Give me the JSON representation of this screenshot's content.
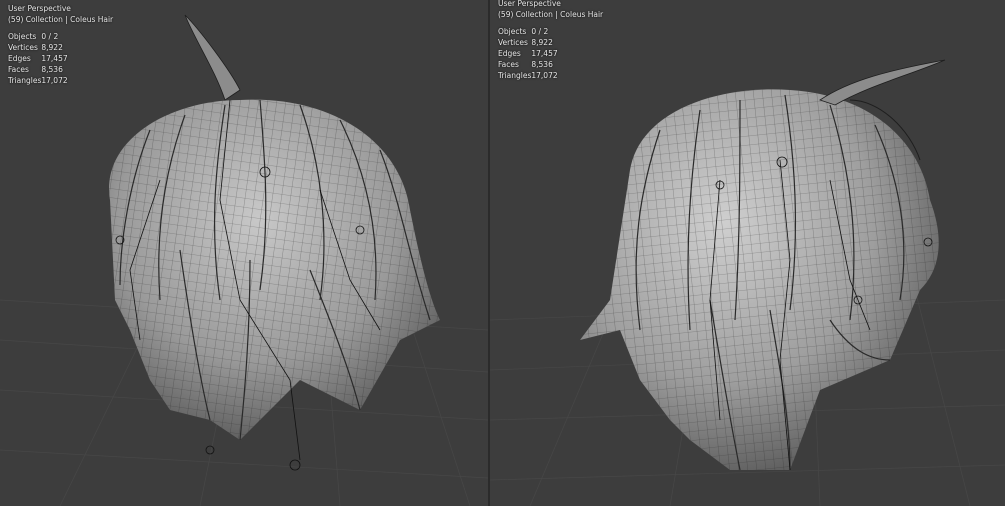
{
  "viewports": [
    {
      "perspective": "User Perspective",
      "collection": "(59) Collection | Coleus Hair",
      "stats": [
        {
          "label": "Objects",
          "value": "0 / 2"
        },
        {
          "label": "Vertices",
          "value": "8,922"
        },
        {
          "label": "Edges",
          "value": "17,457"
        },
        {
          "label": "Faces",
          "value": "8,536"
        },
        {
          "label": "Triangles",
          "value": "17,072"
        }
      ]
    },
    {
      "perspective": "User Perspective",
      "collection": "(59) Collection | Coleus Hair",
      "stats": [
        {
          "label": "Objects",
          "value": "0 / 2"
        },
        {
          "label": "Vertices",
          "value": "8,922"
        },
        {
          "label": "Edges",
          "value": "17,457"
        },
        {
          "label": "Faces",
          "value": "8,536"
        },
        {
          "label": "Triangles",
          "value": "17,072"
        }
      ]
    }
  ],
  "colors": {
    "viewport_bg": "#3d3d3d",
    "grid": "#4a4a4a",
    "mesh": "#9a9a9a",
    "wire": "#1e1e1e",
    "text": "#e6e6e6"
  }
}
